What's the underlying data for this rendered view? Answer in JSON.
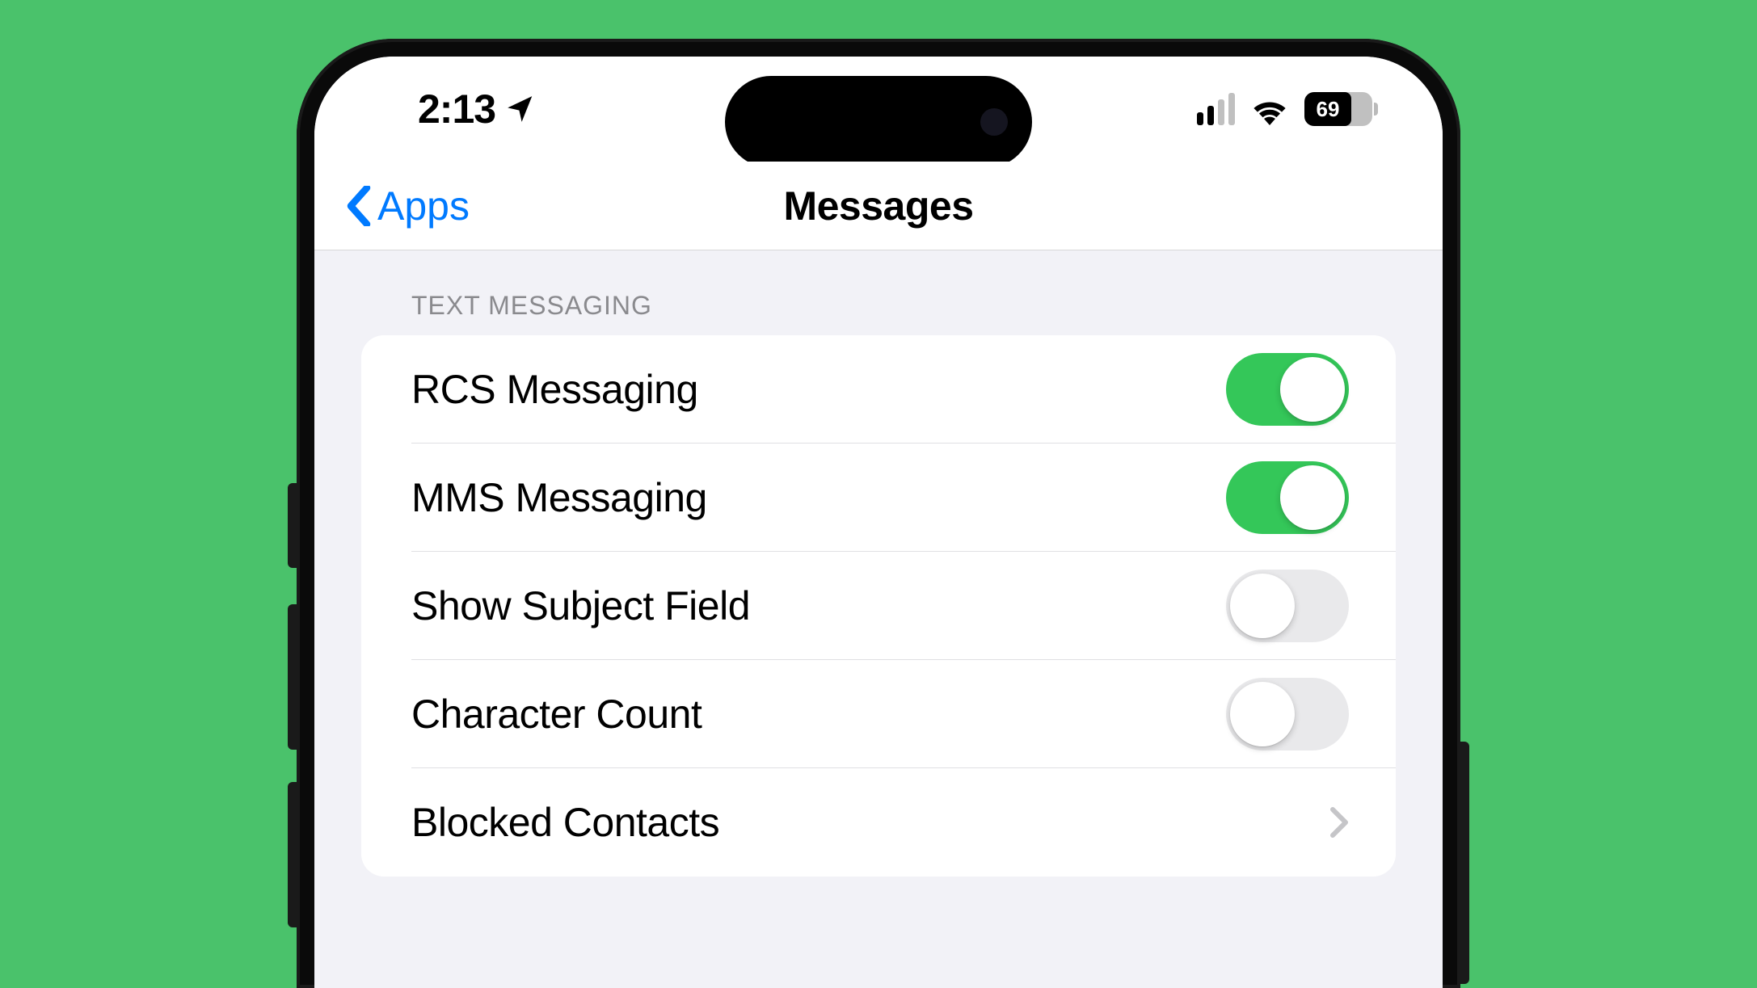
{
  "status": {
    "time": "2:13",
    "battery": "69"
  },
  "nav": {
    "back_label": "Apps",
    "title": "Messages"
  },
  "section": {
    "header": "TEXT MESSAGING",
    "rows": [
      {
        "label": "RCS Messaging",
        "toggle": true,
        "on": true
      },
      {
        "label": "MMS Messaging",
        "toggle": true,
        "on": true
      },
      {
        "label": "Show Subject Field",
        "toggle": true,
        "on": false
      },
      {
        "label": "Character Count",
        "toggle": true,
        "on": false
      },
      {
        "label": "Blocked Contacts",
        "toggle": false
      }
    ]
  }
}
